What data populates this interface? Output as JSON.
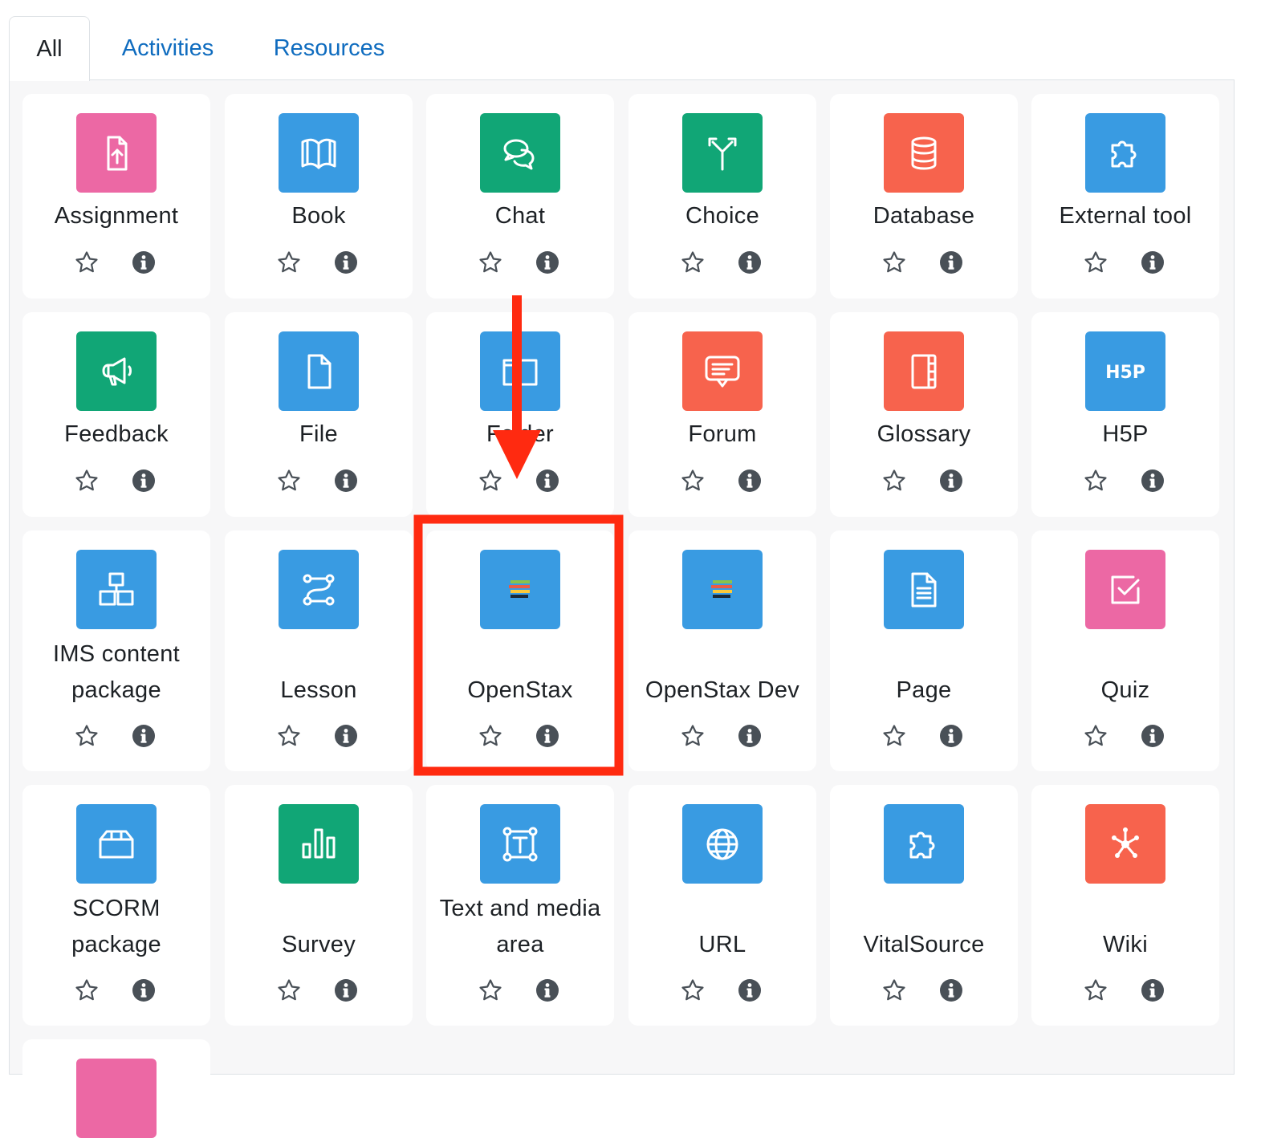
{
  "tabs": [
    {
      "label": "All",
      "active": true
    },
    {
      "label": "Activities",
      "active": false
    },
    {
      "label": "Resources",
      "active": false
    }
  ],
  "colors": {
    "pink": "#ec68a4",
    "blue": "#399be2",
    "green": "#11a676",
    "orange": "#f7634d",
    "link": "#0f6cbf",
    "highlight": "#ff2a10"
  },
  "items": [
    {
      "name": "Assignment",
      "icon": "assignment-icon",
      "color": "#ec68a4"
    },
    {
      "name": "Book",
      "icon": "book-icon",
      "color": "#399be2"
    },
    {
      "name": "Chat",
      "icon": "chat-icon",
      "color": "#11a676"
    },
    {
      "name": "Choice",
      "icon": "choice-icon",
      "color": "#11a676"
    },
    {
      "name": "Database",
      "icon": "database-icon",
      "color": "#f7634d"
    },
    {
      "name": "External tool",
      "icon": "external-tool-icon",
      "color": "#399be2"
    },
    {
      "name": "Feedback",
      "icon": "feedback-icon",
      "color": "#11a676"
    },
    {
      "name": "File",
      "icon": "file-icon",
      "color": "#399be2"
    },
    {
      "name": "Folder",
      "icon": "folder-icon",
      "color": "#399be2"
    },
    {
      "name": "Forum",
      "icon": "forum-icon",
      "color": "#f7634d"
    },
    {
      "name": "Glossary",
      "icon": "glossary-icon",
      "color": "#f7634d"
    },
    {
      "name": "H5P",
      "icon": "h5p-icon",
      "color": "#399be2"
    },
    {
      "name": "IMS content package",
      "icon": "ims-package-icon",
      "color": "#399be2"
    },
    {
      "name": "Lesson",
      "icon": "lesson-icon",
      "color": "#399be2"
    },
    {
      "name": "OpenStax",
      "icon": "openstax-icon",
      "color": "#399be2"
    },
    {
      "name": "OpenStax Dev",
      "icon": "openstax-icon",
      "color": "#399be2"
    },
    {
      "name": "Page",
      "icon": "page-icon",
      "color": "#399be2"
    },
    {
      "name": "Quiz",
      "icon": "quiz-icon",
      "color": "#ec68a4"
    },
    {
      "name": "SCORM package",
      "icon": "scorm-icon",
      "color": "#399be2"
    },
    {
      "name": "Survey",
      "icon": "survey-icon",
      "color": "#11a676"
    },
    {
      "name": "Text and media area",
      "icon": "text-media-icon",
      "color": "#399be2"
    },
    {
      "name": "URL",
      "icon": "url-globe-icon",
      "color": "#399be2"
    },
    {
      "name": "VitalSource",
      "icon": "vitalsource-icon",
      "color": "#399be2"
    },
    {
      "name": "Wiki",
      "icon": "wiki-icon",
      "color": "#f7634d"
    },
    {
      "name": "",
      "icon": "partial-icon",
      "color": "#ec68a4"
    }
  ]
}
